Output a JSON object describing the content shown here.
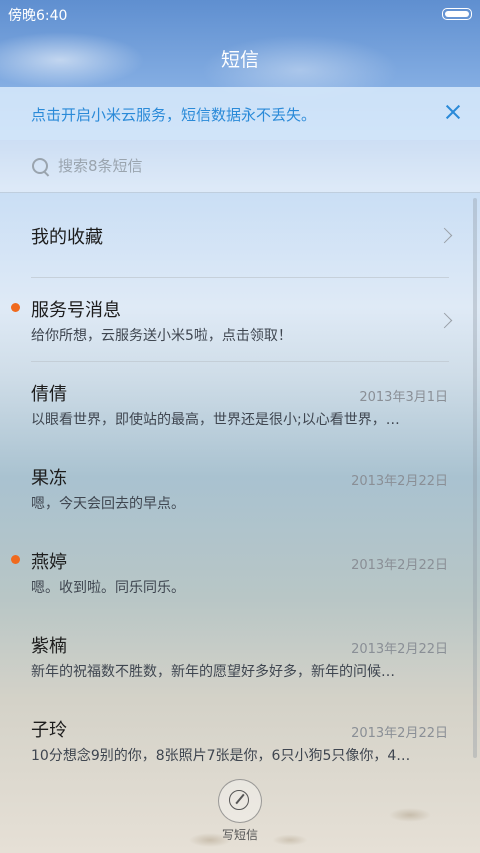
{
  "status": {
    "time": "傍晚6:40"
  },
  "title": "短信",
  "banner": {
    "text": "点击开启小米云服务，短信数据永不丢失。"
  },
  "search": {
    "placeholder": "搜索8条短信"
  },
  "items": [
    {
      "title": "我的收藏",
      "preview": "",
      "date": "",
      "unread": false,
      "chevron": true
    },
    {
      "title": "服务号消息",
      "preview": "给你所想，云服务送小米5啦，点击领取！",
      "date": "",
      "unread": true,
      "chevron": true
    },
    {
      "title": "倩倩",
      "preview": "以眼看世界，即使站的最高，世界还是很小;以心看世界，…",
      "date": "2013年3月1日",
      "unread": false,
      "chevron": false
    },
    {
      "title": "果冻",
      "preview": "嗯，今天会回去的早点。",
      "date": "2013年2月22日",
      "unread": false,
      "chevron": false
    },
    {
      "title": "燕婷",
      "preview": "嗯。收到啦。同乐同乐。",
      "date": "2013年2月22日",
      "unread": true,
      "chevron": false
    },
    {
      "title": "紫楠",
      "preview": "新年的祝福数不胜数，新年的愿望好多好多，新年的问候…",
      "date": "2013年2月22日",
      "unread": false,
      "chevron": false
    },
    {
      "title": "子玲",
      "preview": "10分想念9别的你，8张照片7张是你，6只小狗5只像你，4…",
      "date": "2013年2月22日",
      "unread": false,
      "chevron": false
    }
  ],
  "compose": {
    "label": "写短信",
    "icon": "compose-icon"
  },
  "colors": {
    "accent": "#2a8ad8",
    "unread_dot": "#f06a1e"
  }
}
